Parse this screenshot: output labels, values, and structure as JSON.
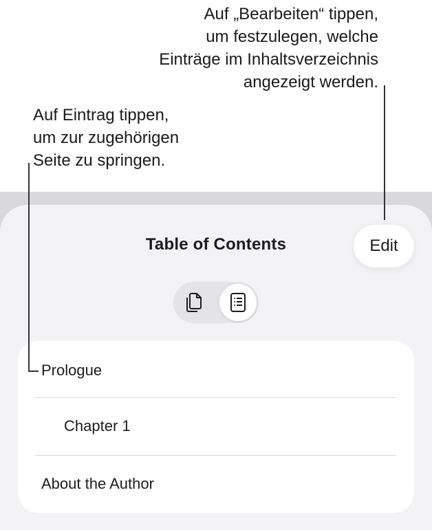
{
  "callouts": {
    "edit_hint": {
      "lines": [
        "Auf „Bearbeiten“ tippen,",
        "um festzulegen, welche",
        "Einträge im Inhaltsverzeichnis",
        "angezeigt werden."
      ]
    },
    "entry_hint": {
      "lines": [
        "Auf Eintrag tippen,",
        "um zur zugehörigen",
        "Seite zu springen."
      ]
    }
  },
  "sheet": {
    "title": "Table of Contents",
    "edit_label": "Edit",
    "view_switcher": {
      "options": [
        {
          "icon": "pages-thumbnail-icon",
          "selected": false
        },
        {
          "icon": "list-icon",
          "selected": true
        }
      ]
    },
    "toc": {
      "items": [
        {
          "label": "Prologue",
          "level": 1
        },
        {
          "label": "Chapter 1",
          "level": 2
        },
        {
          "label": "About the Author",
          "level": 1
        }
      ]
    }
  },
  "colors": {
    "backdrop": "#d9d9dd",
    "sheet": "#f3f3f6",
    "card": "#ffffff",
    "text": "#1c1c1e",
    "separator": "#d8d8dc"
  }
}
